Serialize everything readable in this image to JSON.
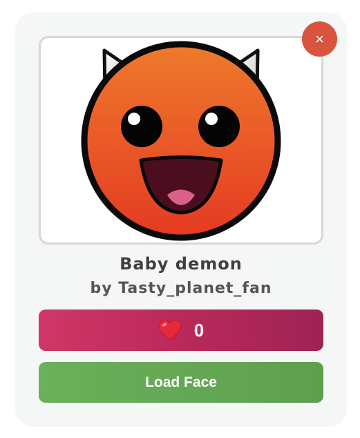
{
  "close_button": {
    "icon": "close-icon",
    "glyph": "×",
    "color": "#d9533e"
  },
  "face": {
    "title": "Baby demon",
    "author": "by Tasty_planet_fan"
  },
  "likes": {
    "icon": "heart-icon",
    "count": "0",
    "color": "#cf3767"
  },
  "load_button": {
    "label": "Load Face",
    "color": "#6bb05b"
  }
}
